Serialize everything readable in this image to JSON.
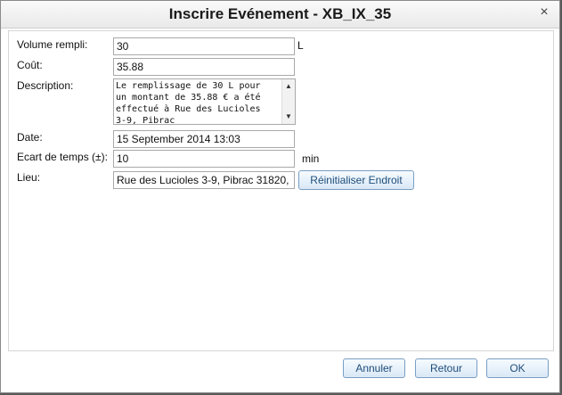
{
  "dialog": {
    "title": "Inscrire Evénement - XB_IX_35",
    "close_glyph": "×"
  },
  "form": {
    "volume_label": "Volume rempli:",
    "volume_value": "30",
    "volume_unit": "L",
    "cost_label": "Coût:",
    "cost_value": "35.88",
    "description_label": "Description:",
    "description_value": "Le remplissage de 30 L pour un montant de 35.88 € a été effectué à Rue des Lucioles 3-9, Pibrac",
    "date_label": "Date:",
    "date_value": "15 September 2014 13:03",
    "time_gap_label": "Ecart de temps (±):",
    "time_gap_value": "10",
    "time_gap_unit": "min",
    "place_label": "Lieu:",
    "place_value": "Rue des Lucioles 3-9, Pibrac 31820,",
    "reset_place_label": "Réinitialiser Endroit"
  },
  "footer": {
    "cancel_label": "Annuler",
    "back_label": "Retour",
    "ok_label": "OK"
  },
  "icons": {
    "scroll_up": "up-arrow-icon",
    "scroll_down": "down-arrow-icon",
    "close": "close-icon"
  }
}
